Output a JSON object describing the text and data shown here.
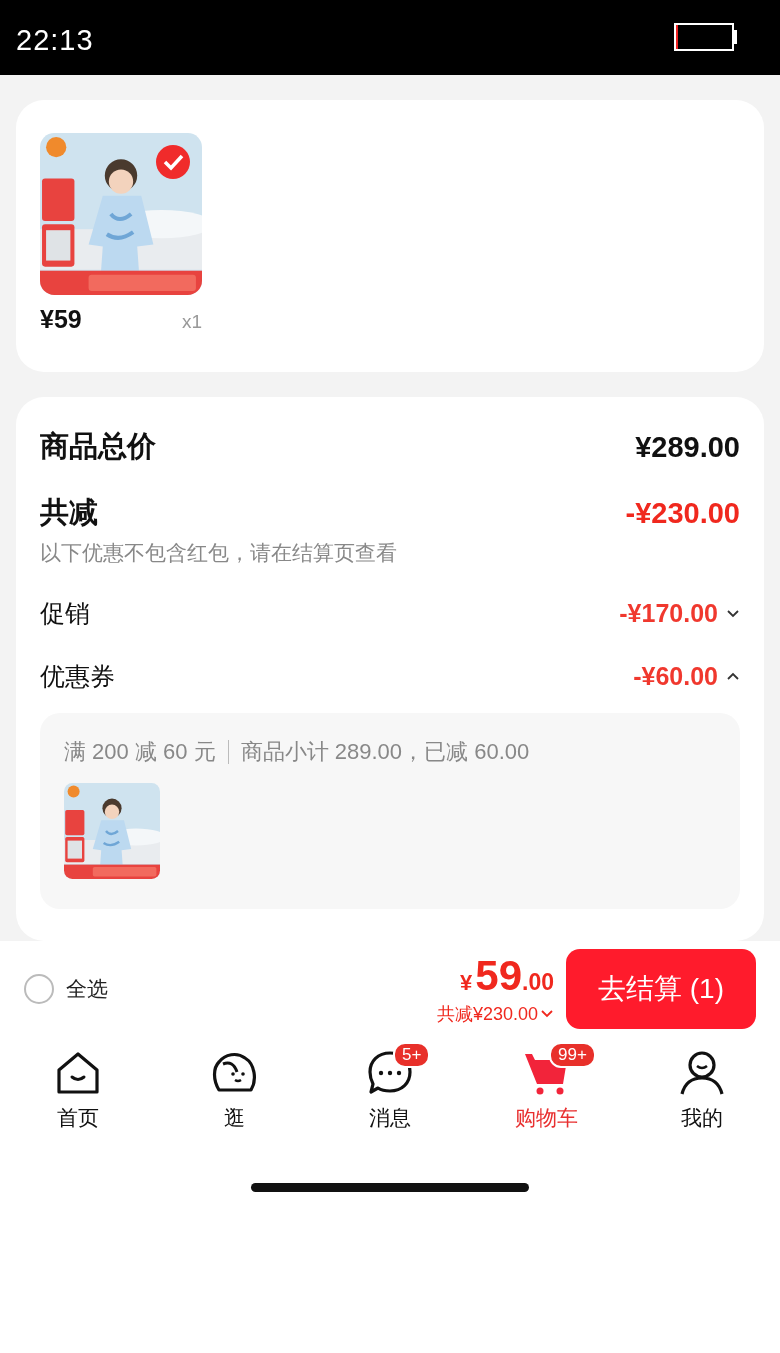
{
  "status_bar": {
    "time": "22:13"
  },
  "cart_items": [
    {
      "kind": "picture",
      "selected": true,
      "price": "¥59",
      "quantity": "x1"
    }
  ],
  "summary": {
    "total_label": "商品总价",
    "total_value": "¥289.00",
    "discount_label": "共减",
    "discount_value": "-¥230.00",
    "note": "以下优惠不包含红包，请在结算页查看",
    "lines": [
      {
        "label": "促销",
        "value": "-¥170.00",
        "expanded": false
      },
      {
        "label": "优惠券",
        "value": "-¥60.00",
        "expanded": true,
        "detail": {
          "rule": "满 200 减 60 元",
          "info": "商品小计 289.00，已减 60.00"
        }
      }
    ]
  },
  "checkout_bar": {
    "select_all": {
      "label": "全选",
      "checked": false
    },
    "currency": "¥",
    "amount": "59",
    "decimals": ".00",
    "discount": "共减¥230.00",
    "button": "去结算 (1)"
  },
  "tab_bar": [
    {
      "label": "首页",
      "selected": false
    },
    {
      "label": "逛",
      "selected": false
    },
    {
      "label": "消息",
      "selected": false,
      "badge": "5+"
    },
    {
      "label": "购物车",
      "selected": true,
      "badge": "99+"
    },
    {
      "label": "我的",
      "selected": false
    }
  ]
}
